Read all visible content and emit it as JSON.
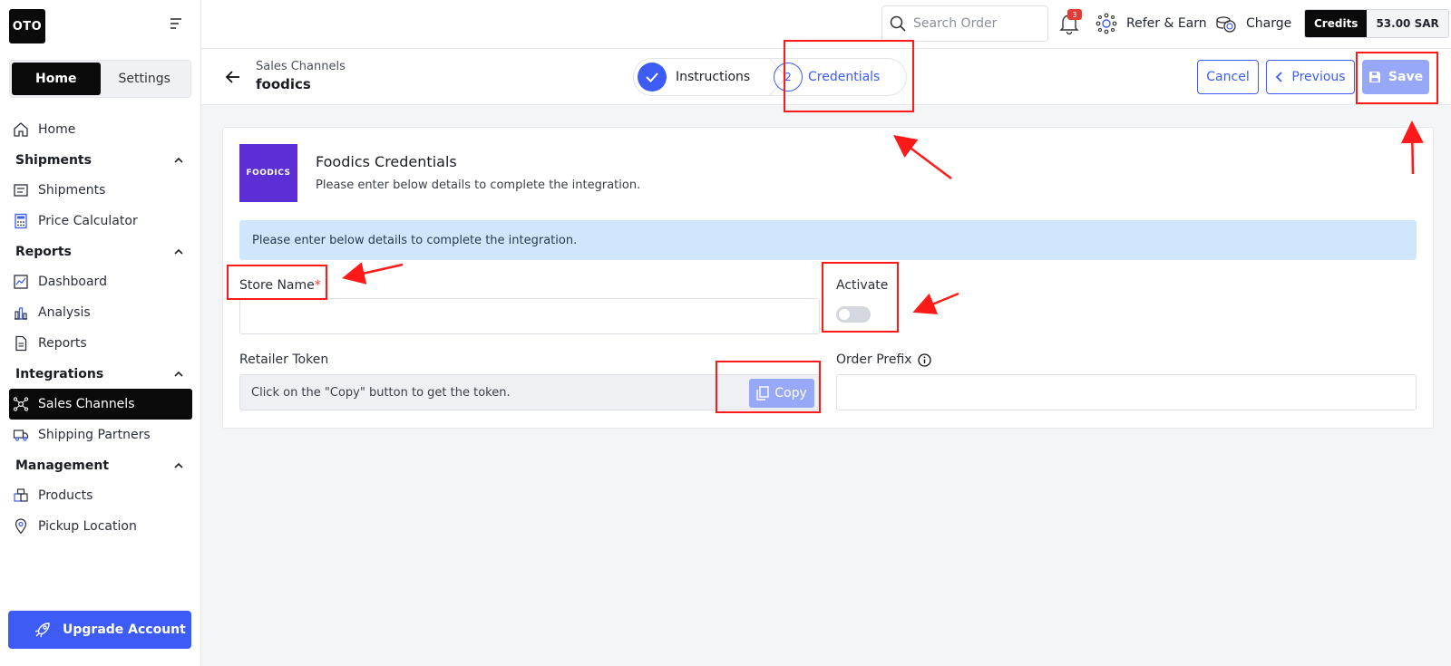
{
  "sidebar": {
    "logo": "OTO",
    "seg": {
      "home": "Home",
      "settings": "Settings"
    },
    "items": [
      {
        "label": "Home"
      },
      {
        "section": "Shipments"
      },
      {
        "label": "Shipments"
      },
      {
        "label": "Price Calculator"
      },
      {
        "section": "Reports"
      },
      {
        "label": "Dashboard"
      },
      {
        "label": "Analysis"
      },
      {
        "label": "Reports"
      },
      {
        "section": "Integrations"
      },
      {
        "label": "Sales Channels"
      },
      {
        "label": "Shipping Partners"
      },
      {
        "section": "Management"
      },
      {
        "label": "Products"
      },
      {
        "label": "Pickup Location"
      }
    ],
    "upgrade": "Upgrade Account"
  },
  "topbar": {
    "search_placeholder": "Search Order",
    "notifications_count": "3",
    "refer": "Refer & Earn",
    "charge": "Charge",
    "credits_label": "Credits",
    "credits_value": "53.00 SAR"
  },
  "subheader": {
    "breadcrumb": "Sales Channels",
    "page_title": "foodics",
    "steps": [
      {
        "label": "Instructions"
      },
      {
        "number": "2",
        "label": "Credentials"
      }
    ],
    "cancel": "Cancel",
    "previous": "Previous",
    "save": "Save"
  },
  "card": {
    "brand_logo_text": "FOODICS",
    "title": "Foodics Credentials",
    "subtitle": "Please enter below details to complete the integration.",
    "alert": "Please enter below details to complete the integration.",
    "store_name_label": "Store Name",
    "required_mark": "*",
    "activate_label": "Activate",
    "retailer_token_label": "Retailer Token",
    "token_hint": "Click on the \"Copy\" button to get the token.",
    "copy": "Copy",
    "order_prefix_label": "Order Prefix"
  },
  "colors": {
    "accent": "#3d5cf5",
    "accent_light": "#98a8f8",
    "annotation": "#ff1a1a",
    "brand": "#5b2fd3",
    "alert_bg": "#cfe6fc"
  }
}
